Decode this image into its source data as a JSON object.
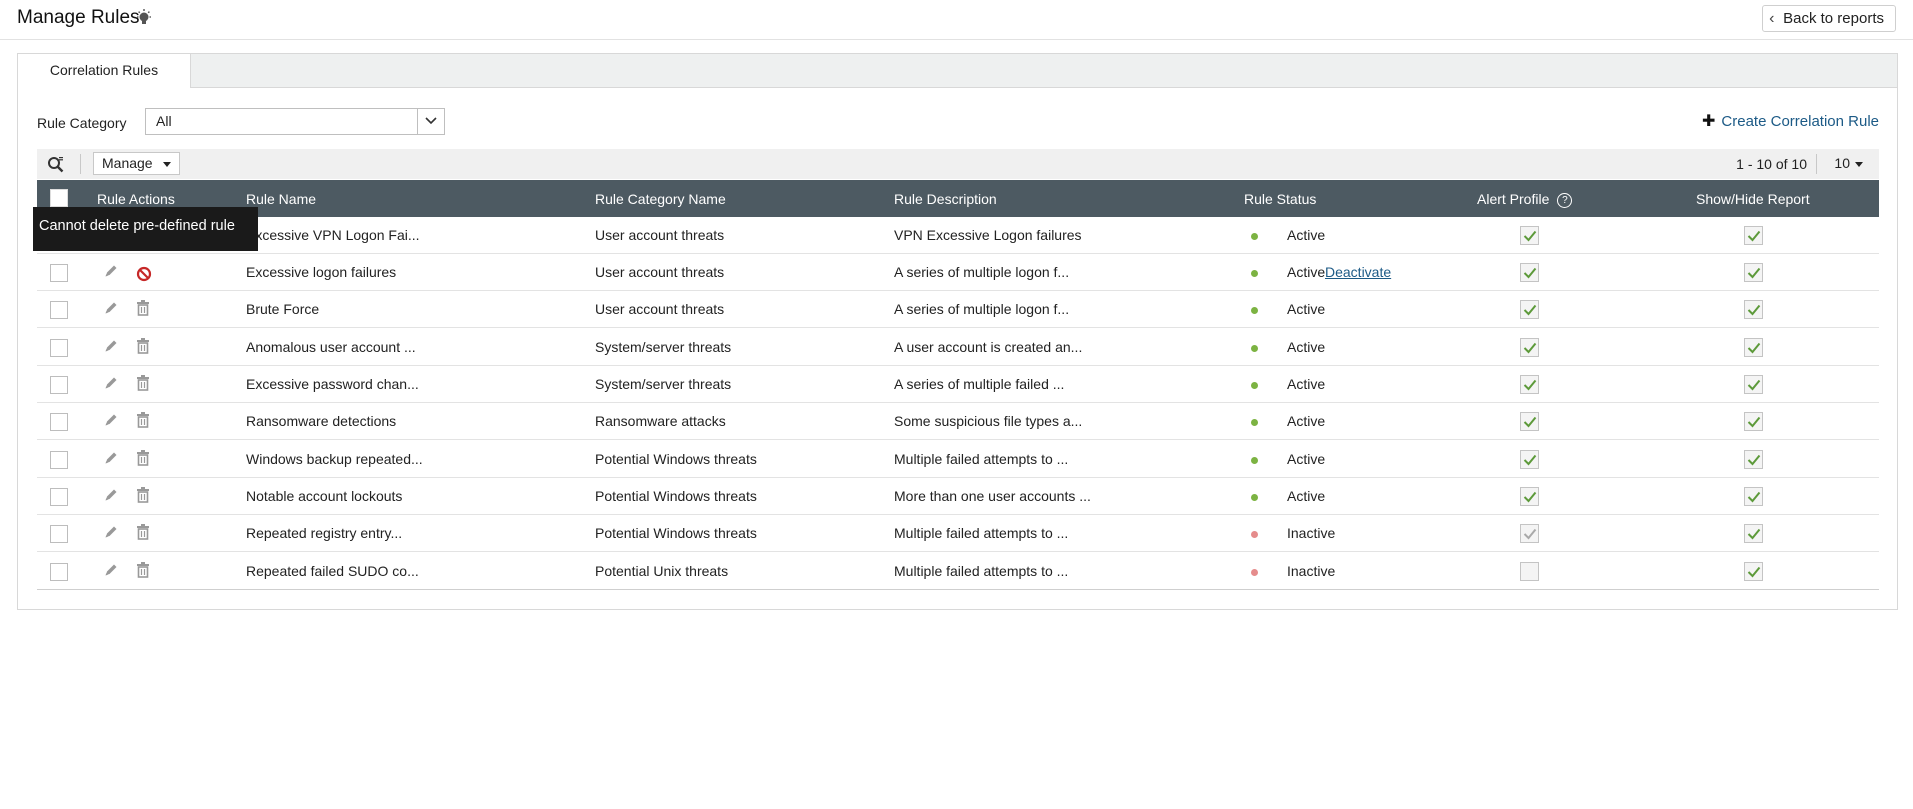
{
  "page": {
    "title": "Manage Rules",
    "back_label": "Back to reports"
  },
  "tabs": [
    {
      "label": "Correlation Rules",
      "active": true
    }
  ],
  "filter": {
    "label": "Rule Category",
    "selected": "All"
  },
  "create_label": "Create Correlation Rule",
  "toolbar": {
    "manage_label": "Manage",
    "paging_text": "1 - 10 of 10",
    "per_page": "10"
  },
  "columns": {
    "actions": "Rule Actions",
    "name": "Rule Name",
    "category": "Rule Category Name",
    "description": "Rule Description",
    "status": "Rule Status",
    "alert": "Alert Profile",
    "show": "Show/Hide Report"
  },
  "tooltip": "Cannot delete pre-defined rule",
  "colors": {
    "header_bg": "#4d5a62",
    "link": "#1c5a86",
    "active_dot": "#7cb342",
    "inactive_dot": "#e58c8c",
    "check": "#5d9a3a"
  },
  "rows": [
    {
      "name": "Excessive VPN Logon Fai...",
      "category": "User account threats",
      "description": "VPN Excessive Logon failures",
      "status": "Active",
      "alert_checked": true,
      "show_checked": true
    },
    {
      "name": "Excessive logon failures",
      "category": "User account threats",
      "description": "A series of multiple logon f...",
      "status": "Active",
      "action": "Deactivate",
      "alert_checked": true,
      "show_checked": true
    },
    {
      "name": "Brute Force",
      "category": "User account threats",
      "description": "A series of multiple logon f...",
      "status": "Active",
      "alert_checked": true,
      "show_checked": true
    },
    {
      "name": "Anomalous user account ...",
      "category": "System/server threats",
      "description": "A user account is created an...",
      "status": "Active",
      "alert_checked": true,
      "show_checked": true
    },
    {
      "name": "Excessive password chan...",
      "category": "System/server threats",
      "description": "A series of multiple failed ...",
      "status": "Active",
      "alert_checked": true,
      "show_checked": true
    },
    {
      "name": "Ransomware detections",
      "category": "Ransomware attacks",
      "description": "Some suspicious file types a...",
      "status": "Active",
      "alert_checked": true,
      "show_checked": true
    },
    {
      "name": "Windows backup repeated...",
      "category": "Potential Windows threats",
      "description": "Multiple failed attempts to ...",
      "status": "Active",
      "alert_checked": true,
      "show_checked": true
    },
    {
      "name": "Notable account lockouts",
      "category": "Potential Windows threats",
      "description": "More than one user accounts ...",
      "status": "Active",
      "alert_checked": true,
      "show_checked": true
    },
    {
      "name": "Repeated registry entry...",
      "category": "Potential Windows threats",
      "description": "Multiple failed attempts to ...",
      "status": "Inactive",
      "alert_checked": true,
      "alert_dim": true,
      "show_checked": true
    },
    {
      "name": "Repeated failed SUDO co...",
      "category": "Potential Unix threats",
      "description": "Multiple failed attempts to ...",
      "status": "Inactive",
      "alert_checked": false,
      "show_checked": true
    }
  ]
}
